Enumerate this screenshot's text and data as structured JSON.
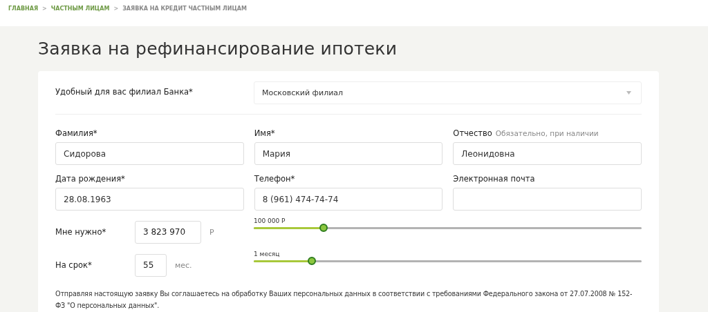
{
  "breadcrumbs": [
    {
      "label": "ГЛАВНАЯ",
      "current": false
    },
    {
      "label": "ЧАСТНЫМ ЛИЦАМ",
      "current": false
    },
    {
      "label": "ЗАЯВКА НА КРЕДИТ ЧАСТНЫМ ЛИЦАМ",
      "current": true
    }
  ],
  "breadcrumb_separator": ">",
  "title": "Заявка на рефинансирование ипотеки",
  "branch": {
    "label": "Удобный для вас филиал Банка*",
    "value": "Московский филиал"
  },
  "fields": [
    {
      "label": "Фамилия*",
      "value": "Сидорова"
    },
    {
      "label": "Имя*",
      "value": "Мария"
    },
    {
      "label": "Отчество",
      "hint": "Обязательно, при наличии",
      "value": "Леонидовна"
    },
    {
      "label": "Дата рождения*",
      "value": "28.08.1963"
    },
    {
      "label": "Телефон*",
      "value": "8 (961) 474-74-74"
    },
    {
      "label": "Электронная почта"
    }
  ],
  "amounts": [
    {
      "label": "Мне нужно*",
      "value": "3 823 970",
      "unit": "Р",
      "min_label": "100 000 Р",
      "level": 0.18,
      "wide": true
    },
    {
      "label": "На срок*",
      "value": "55",
      "unit": "мес.",
      "min_label": "1 месяц",
      "level": 0.15,
      "wide": false
    }
  ],
  "consent": "Отправляя настоящую заявку Вы соглашаетесь на обработку Ваших персональных данных в соответствии с требованиями Федерального закона от 27.07.2008 № 152-ФЗ \"О персональных данных\"."
}
